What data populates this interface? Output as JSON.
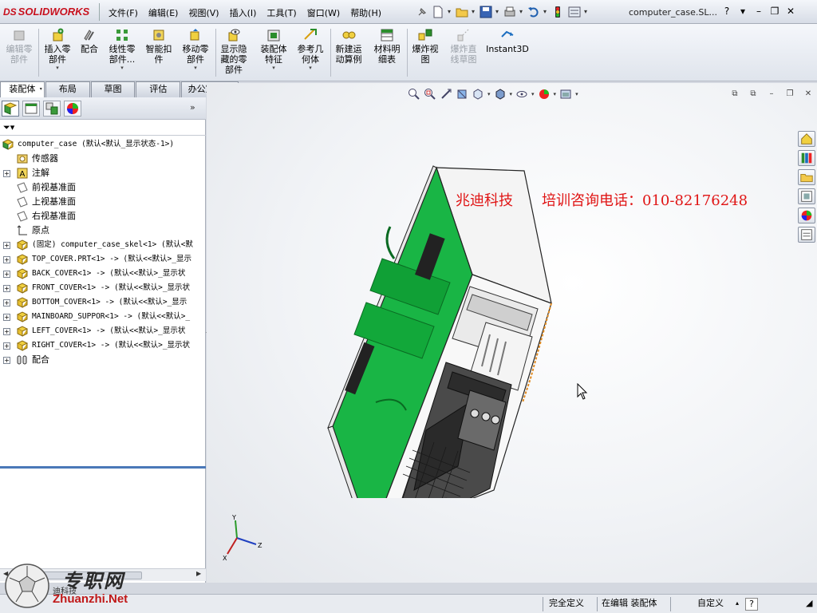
{
  "titlebar": {
    "logo": "SOLIDWORKS",
    "logo_mark": "DS",
    "menu": [
      "文件(F)",
      "编辑(E)",
      "视图(V)",
      "插入(I)",
      "工具(T)",
      "窗口(W)",
      "帮助(H)"
    ],
    "doc_title": "computer_case.SL...",
    "help_label": "?"
  },
  "command_manager": {
    "buttons": [
      {
        "label": "编辑零\n部件",
        "icon": "edit-component-icon",
        "enabled": false
      },
      {
        "label": "插入零\n部件",
        "icon": "insert-component-icon",
        "enabled": true
      },
      {
        "label": "配合",
        "icon": "mate-icon",
        "enabled": true
      },
      {
        "label": "线性零\n部件...",
        "icon": "linear-pattern-icon",
        "enabled": true
      },
      {
        "label": "智能扣\n件",
        "icon": "smart-fastener-icon",
        "enabled": true
      },
      {
        "label": "移动零\n部件",
        "icon": "move-component-icon",
        "enabled": true
      },
      {
        "label": "显示隐\n藏的零\n部件",
        "icon": "show-hidden-icon",
        "enabled": true
      },
      {
        "label": "装配体\n特征",
        "icon": "assembly-feature-icon",
        "enabled": true
      },
      {
        "label": "参考几\n何体",
        "icon": "reference-geometry-icon",
        "enabled": true
      },
      {
        "label": "新建运\n动算例",
        "icon": "motion-study-icon",
        "enabled": true
      },
      {
        "label": "材料明\n细表",
        "icon": "bom-icon",
        "enabled": true
      },
      {
        "label": "爆炸视\n图",
        "icon": "exploded-view-icon",
        "enabled": true
      },
      {
        "label": "爆炸直\n线草图",
        "icon": "explode-line-sketch-icon",
        "enabled": false
      },
      {
        "label": "Instant3D",
        "icon": "instant3d-icon",
        "enabled": true
      }
    ]
  },
  "tabs": [
    "装配体",
    "布局",
    "草图",
    "评估",
    "办公室产品"
  ],
  "feature_tree": {
    "root": "computer_case  (默认<默认_显示状态-1>)",
    "items": [
      {
        "label": "传感器",
        "icon": "sensor-icon",
        "expand": false
      },
      {
        "label": "注解",
        "icon": "annotation-icon",
        "expand": true
      },
      {
        "label": "前视基准面",
        "icon": "plane-icon",
        "expand": false
      },
      {
        "label": "上视基准面",
        "icon": "plane-icon",
        "expand": false
      },
      {
        "label": "右视基准面",
        "icon": "plane-icon",
        "expand": false
      },
      {
        "label": "原点",
        "icon": "origin-icon",
        "expand": false
      },
      {
        "label": "(固定) computer_case_skel<1> (默认<默",
        "icon": "part-icon",
        "expand": true,
        "mono": true
      },
      {
        "label": "TOP_COVER.PRT<1> -> (默认<<默认>_显示",
        "icon": "part-icon",
        "expand": true,
        "mono": true
      },
      {
        "label": "BACK_COVER<1> -> (默认<<默认>_显示状",
        "icon": "part-icon",
        "expand": true,
        "mono": true
      },
      {
        "label": "FRONT_COVER<1> -> (默认<<默认>_显示状",
        "icon": "part-icon",
        "expand": true,
        "mono": true
      },
      {
        "label": "BOTTOM_COVER<1> -> (默认<<默认>_显示",
        "icon": "part-icon",
        "expand": true,
        "mono": true
      },
      {
        "label": "MAINBOARD_SUPPOR<1> -> (默认<<默认>_",
        "icon": "part-icon",
        "expand": true,
        "mono": true
      },
      {
        "label": "LEFT_COVER<1> -> (默认<<默认>_显示状",
        "icon": "part-icon",
        "expand": true,
        "mono": true
      },
      {
        "label": "RIGHT_COVER<1> -> (默认<<默认>_显示状",
        "icon": "part-icon",
        "expand": true,
        "mono": true
      },
      {
        "label": "配合",
        "icon": "mates-folder-icon",
        "expand": true
      }
    ]
  },
  "viewport": {
    "overlay_company": "兆迪科技",
    "overlay_phone": "培训咨询电话：010-82176248"
  },
  "status_bar": {
    "state": "完全定义",
    "editing": "在编辑 装配体",
    "custom": "自定义",
    "help": "?"
  },
  "watermark": {
    "cn": "专职网",
    "en": "Zhuanzhi.Net",
    "small": "迪科技"
  },
  "colors": {
    "accent_green": "#19b545",
    "overlay_red": "#e01515",
    "brand_red": "#c8101d"
  }
}
